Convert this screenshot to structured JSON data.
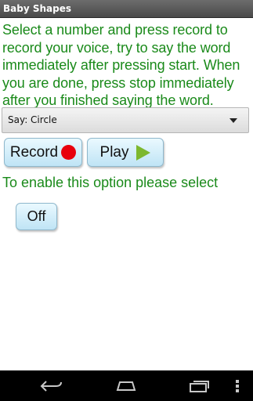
{
  "app": {
    "title": "Baby Shapes"
  },
  "instructions": "Select a number and press record to record your voice, try to say the word immediately after pressing start. When you are done, press stop immediately after you finished saying the word.",
  "spinner": {
    "selected": "Say: Circle"
  },
  "buttons": {
    "record": "Record",
    "play": "Play",
    "off": "Off"
  },
  "enable_text": "To enable this option please select",
  "colors": {
    "text_green": "#1a8a1a",
    "record_red": "#e8000c",
    "play_green": "#7db82e",
    "button_blue": "#bfe4f5"
  },
  "icons": {
    "record": "record-dot-icon",
    "play": "play-triangle-icon",
    "back": "back-icon",
    "home": "home-icon",
    "recent": "recent-apps-icon",
    "menu": "menu-icon"
  }
}
